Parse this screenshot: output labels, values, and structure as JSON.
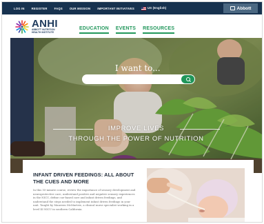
{
  "topbar": {
    "links": [
      "LOG IN",
      "REGISTER",
      "FAQS",
      "OUR MISSION",
      "IMPORTANT INITIATIVES"
    ],
    "locale": "US (English)",
    "partner": "Abbott"
  },
  "brand": {
    "name": "ANHI",
    "subtitle_line1": "ABBOTT NUTRITION",
    "subtitle_line2": "HEALTH INSTITUTE"
  },
  "nav": [
    {
      "label": "EDUCATION"
    },
    {
      "label": "EVENTS"
    },
    {
      "label": "RESOURCES"
    }
  ],
  "hero": {
    "search_label": "I want to...",
    "tagline_line1": "IMPROVE LIVES",
    "tagline_line2": "THROUGH THE POWER OF NUTRITION"
  },
  "feature": {
    "title": "INFANT DRIVEN FEEDINGS: ALL ABOUT THE CUES AND MORE",
    "body": "In this 55-minute course, review the importance of sensory development and neuroprotective care, understand positive and negative sensory experiences in the NICU, define cue-based care and infant driven feedings, and understand the steps needed to implement infant driven feedings in your unit. Taught by Maureen McMurtrie, a clinical nurse specialist working in a level III NICU in southern California."
  },
  "colors": {
    "topbar": "#17324f",
    "accent_green": "#20965a",
    "brand_navy": "#1e3a5c"
  }
}
